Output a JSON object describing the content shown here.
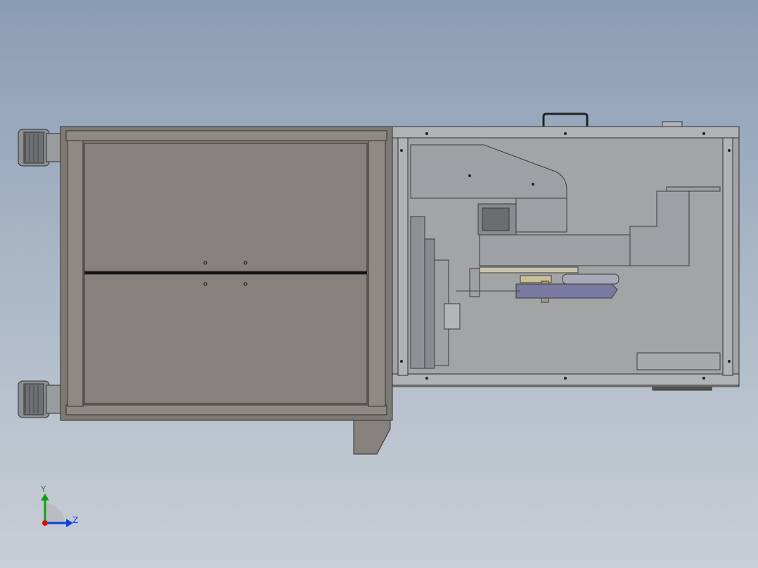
{
  "viewport": {
    "background_top": "#8a9cb4",
    "background_bottom": "#c9ced6"
  },
  "model": {
    "frame_color": "#7d7a73",
    "panel_color": "#86817c",
    "cover_color": "#a3a4a6",
    "edge_color": "#3a3a3a",
    "purple_part_color": "#7a7aa0"
  },
  "triad": {
    "x_axis_color": "#d01010",
    "y_axis_color": "#10a010",
    "z_axis_color": "#1040d0",
    "y_label": "Y",
    "z_label": "Z"
  }
}
